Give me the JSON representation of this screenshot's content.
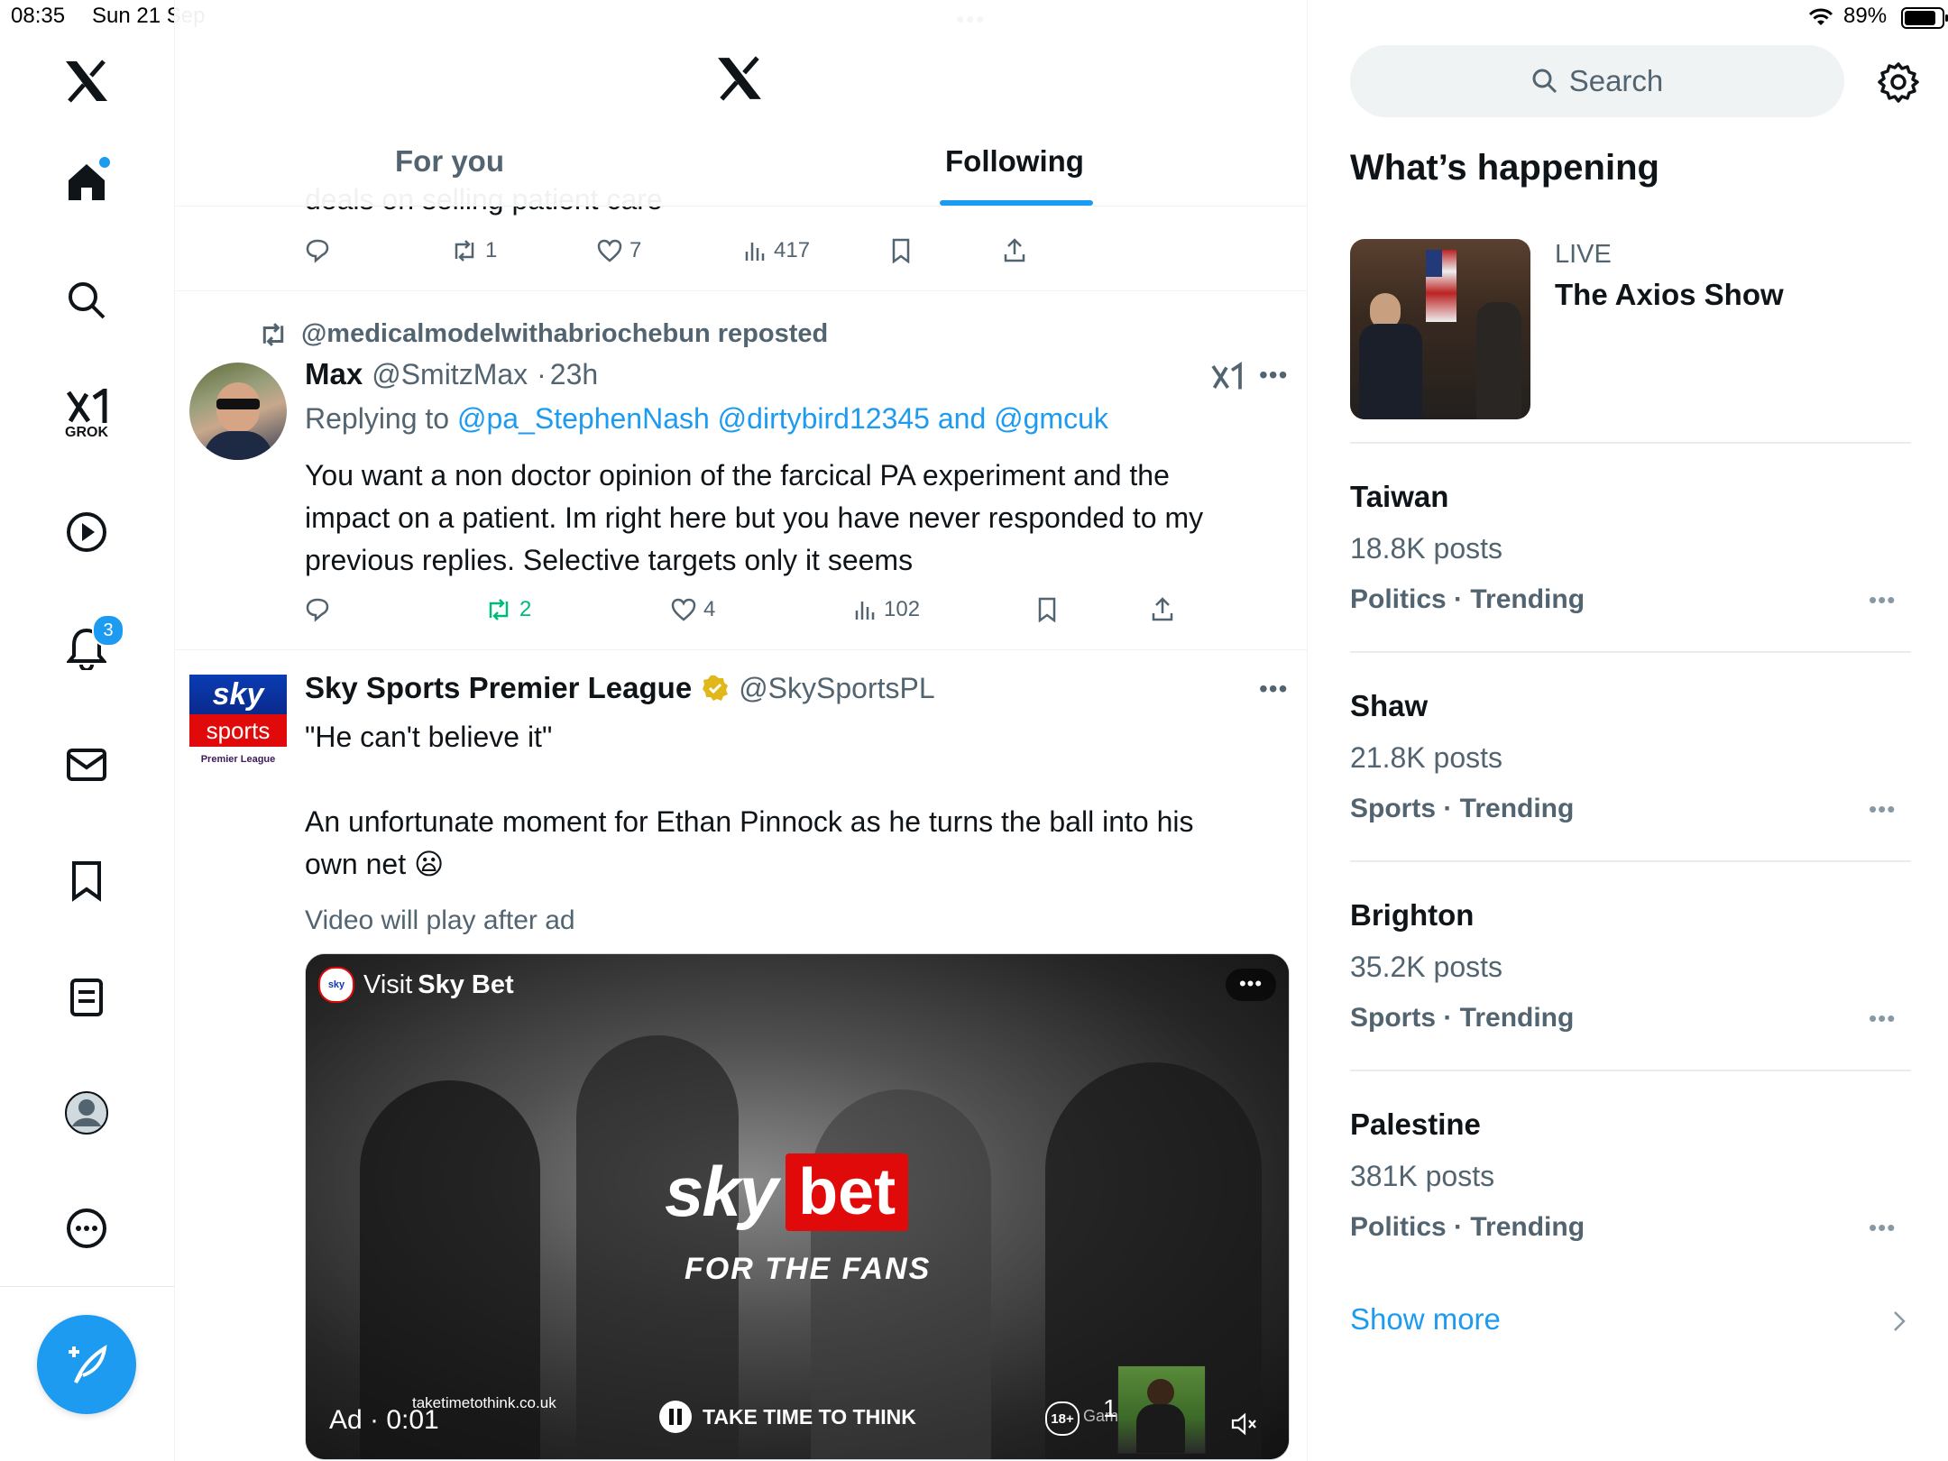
{
  "status_bar": {
    "time": "08:35",
    "date": "Sun 21 Sep",
    "battery": "89%",
    "center_dots": "•••"
  },
  "nav": {
    "items": [
      {
        "name": "x-logo",
        "icon": "x-logo"
      },
      {
        "name": "home",
        "icon": "home-icon"
      },
      {
        "name": "explore",
        "icon": "search-icon"
      },
      {
        "name": "grok",
        "icon": "grok-icon",
        "label": "GROK"
      },
      {
        "name": "video",
        "icon": "play-icon"
      },
      {
        "name": "notifications",
        "icon": "bell-icon",
        "badge": "3"
      },
      {
        "name": "messages",
        "icon": "mail-icon"
      },
      {
        "name": "bookmarks",
        "icon": "bookmark-icon"
      },
      {
        "name": "lists",
        "icon": "list-icon"
      },
      {
        "name": "profile",
        "icon": "avatar-icon"
      },
      {
        "name": "more",
        "icon": "more-icon"
      }
    ],
    "compose_icon": "compose-icon"
  },
  "header": {
    "tabs": [
      {
        "label": "For you",
        "active": false
      },
      {
        "label": "Following",
        "active": true
      }
    ]
  },
  "feed": {
    "partial_tweet": {
      "text_fragment": "deals on selling patient care",
      "replies": "",
      "reposts": "1",
      "likes": "7",
      "views": "417"
    },
    "tweet1": {
      "repost_by": "@medicalmodelwithabriochebun reposted",
      "name": "Max",
      "handle": "@SmitzMax",
      "separator": "·",
      "time": "23h",
      "replying_prefix": "Replying to",
      "replying_to": "@pa_StephenNash @dirtybird12345 and @gmcuk",
      "text_lines": [
        "You want a non doctor opinion of the farcical PA experiment and the",
        "impact on a patient.  Im right here but you have never responded to my",
        "previous replies.  Selective targets only it seems"
      ],
      "reposts": "2",
      "likes": "4",
      "views": "102"
    },
    "tweet2": {
      "name": "Sky Sports Premier League",
      "handle": "@SkySportsPL",
      "verified_color": "#e2b719",
      "avatar_top": "sky",
      "avatar_bottom": "sports",
      "avatar_sub": "Premier League",
      "text_line1": "\"He can't believe it\"",
      "text_line2": "An unfortunate moment for Ethan Pinnock as he turns the ball into his",
      "text_line3": "own net",
      "emoji": "😦",
      "video_note": "Video will play after ad",
      "video": {
        "visit_prefix": "Visit",
        "visit_brand": "Sky Bet",
        "logo_sky": "sky",
        "logo_bet": "bet",
        "slogan": "FOR THE FANS",
        "ad_label": "Ad · 0:01",
        "site": "taketimetothink.co.uk",
        "take_time": "TAKE TIME TO THINK",
        "age": "18+",
        "gam": "Gam",
        "one": "1"
      }
    }
  },
  "sidebar": {
    "search_placeholder": "Search",
    "whats_happening": "What’s happening",
    "live": {
      "label": "LIVE",
      "title": "The Axios Show"
    },
    "trends": [
      {
        "title": "Taiwan",
        "count": "18.8K posts",
        "category": "Politics · Trending"
      },
      {
        "title": "Shaw",
        "count": "21.8K posts",
        "category": "Sports · Trending"
      },
      {
        "title": "Brighton",
        "count": "35.2K posts",
        "category": "Sports · Trending"
      },
      {
        "title": "Palestine",
        "count": "381K posts",
        "category": "Politics · Trending"
      }
    ],
    "show_more": "Show more"
  },
  "colors": {
    "accent": "#1d9bf0",
    "repost_green": "#00ba7c",
    "muted": "#536471",
    "sky_red": "#e10a0a",
    "sky_blue": "#0a3cb4"
  }
}
